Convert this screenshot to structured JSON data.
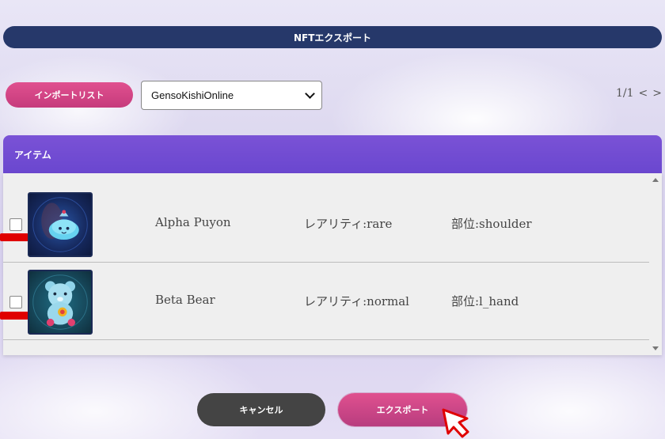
{
  "header": {
    "title": "NFTエクスポート"
  },
  "toolbar": {
    "import_list_label": "インポートリスト",
    "game_select": {
      "selected": "GensoKishiOnline"
    },
    "pager": {
      "label": "1/1",
      "prev": "<",
      "next": ">"
    }
  },
  "table": {
    "column_header": "アイテム",
    "rows": [
      {
        "name": "Alpha Puyon",
        "rarity": "レアリティ:rare",
        "slot": "部位:shoulder",
        "icon": "puyon-icon"
      },
      {
        "name": "Beta Bear",
        "rarity": "レアリティ:normal",
        "slot": "部位:l_hand",
        "icon": "bear-icon"
      }
    ]
  },
  "actions": {
    "cancel_label": "キャンセル",
    "export_label": "エクスポート"
  },
  "colors": {
    "header_bar": "#26386a",
    "primary_pink": "#d0478a",
    "table_header_purple": "#6f4bd2",
    "cancel_gray": "#444444",
    "marker_red": "#e00000"
  }
}
